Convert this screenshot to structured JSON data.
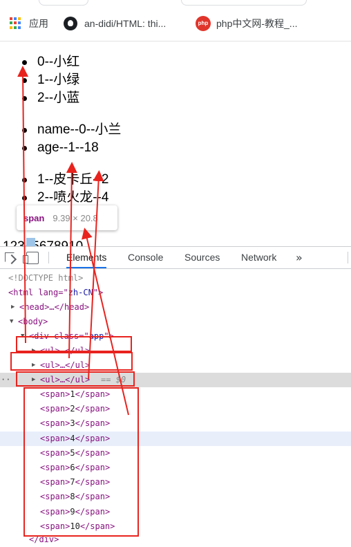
{
  "bookmarks": [
    {
      "label": "应用",
      "icon": "apps-grid-icon"
    },
    {
      "label": "an-didi/HTML: thi...",
      "icon": "github-icon"
    },
    {
      "label": "php中文网-教程_...",
      "icon": "php-icon",
      "icon_text": "php"
    }
  ],
  "page": {
    "list1": [
      "0--小红",
      "1--小绿",
      "2--小蓝"
    ],
    "list2": [
      "name--0--小兰",
      "age--1--18"
    ],
    "list3": [
      "1--皮卡丘--2",
      "2--喷火龙--4"
    ],
    "spans_text": "12345678910"
  },
  "tooltip": {
    "tag": "span",
    "size": "9.39 × 20.8"
  },
  "devtools": {
    "tabs": [
      "Elements",
      "Console",
      "Sources",
      "Network"
    ],
    "active_tab": "Elements",
    "more": "»",
    "doctype": "<!DOCTYPE html>",
    "html_open_prefix": "<html lang=\"",
    "html_lang": "zh-CN",
    "html_open_suffix": "\">",
    "head_row": "<head>…</head>",
    "body_open": "<body>",
    "div_open_prefix": "<div class=\"",
    "div_class": "app",
    "div_open_suffix": "\">",
    "ul_row": "<ul>…</ul>",
    "selected_marker": "== $0",
    "dots": "··",
    "spans": [
      "1",
      "2",
      "3",
      "4",
      "5",
      "6",
      "7",
      "8",
      "9",
      "10"
    ],
    "span_open": "<span>",
    "span_close": "</span>",
    "div_close": "</div>"
  },
  "colors": {
    "annotation_red": "#e8231e",
    "tag_purple": "#881280",
    "attr_brown": "#994500",
    "value_blue": "#1a1aa6",
    "active_tab_blue": "#1a73e8"
  }
}
